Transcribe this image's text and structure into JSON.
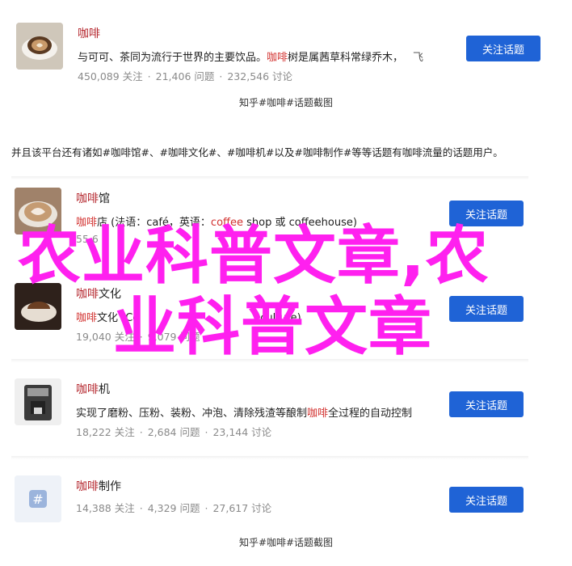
{
  "colors": {
    "accent": "#1f63d6",
    "title": "#b5282f",
    "overlay": "#ff20ef"
  },
  "card1": {
    "title": "咖啡",
    "desc_pre": "与可可、茶同为流行于世界的主要饮品。",
    "desc_hl": "咖啡",
    "desc_post": "树是属茜草科常绿乔木，",
    "desc_more": "飞",
    "followers": "450,089 关注",
    "questions": "21,406 问题",
    "discussions": "232,546 讨论",
    "button": "关注话题",
    "icons": [
      "coffee-cup-icon"
    ]
  },
  "caption_top": "知乎#咖啡#话题截图",
  "intro": "并且该平台还有诸如#咖啡馆#、#咖啡文化#、#咖啡机#以及#咖啡制作#等等话题有咖啡流量的话题用户。",
  "topics": [
    {
      "title_hl": "咖啡",
      "title_rest": "馆",
      "desc_hl": "咖啡",
      "desc_mid": "店 (法语：café，英语：",
      "desc_hl2": "co",
      "desc_hl3": "ffee",
      "desc_post": " shop 或 coffeehouse)",
      "followers": "55,6",
      "questions": "",
      "discussions": "",
      "button": "关注话题"
    },
    {
      "title_hl": "咖啡",
      "title_rest": "文化",
      "desc_hl": "咖啡",
      "desc_mid": "文化 (Co",
      "desc_post": "culture)",
      "desc_tail": "",
      "followers": "19,040 关注",
      "questions": "9,079 问题",
      "discussions": "",
      "button": "关注话题"
    },
    {
      "title_hl": "咖啡",
      "title_rest": "机",
      "desc_pre": "实现了磨粉、压粉、装粉、冲泡、清除残渣等酿制",
      "desc_hl": "咖啡",
      "desc_post": "全过程的自动控制",
      "followers": "18,222 关注",
      "questions": "2,684 问题",
      "discussions": "23,144 讨论",
      "button": "关注话题"
    },
    {
      "title_hl": "咖啡",
      "title_rest": "制作",
      "followers": "14,388 关注",
      "questions": "4,329 问题",
      "discussions": "27,617 讨论",
      "button": "关注话题"
    }
  ],
  "caption_bottom": "知乎#咖啡#话题截图",
  "overlay_line1": "农业科普文章,农",
  "overlay_line2": "业科普文章"
}
